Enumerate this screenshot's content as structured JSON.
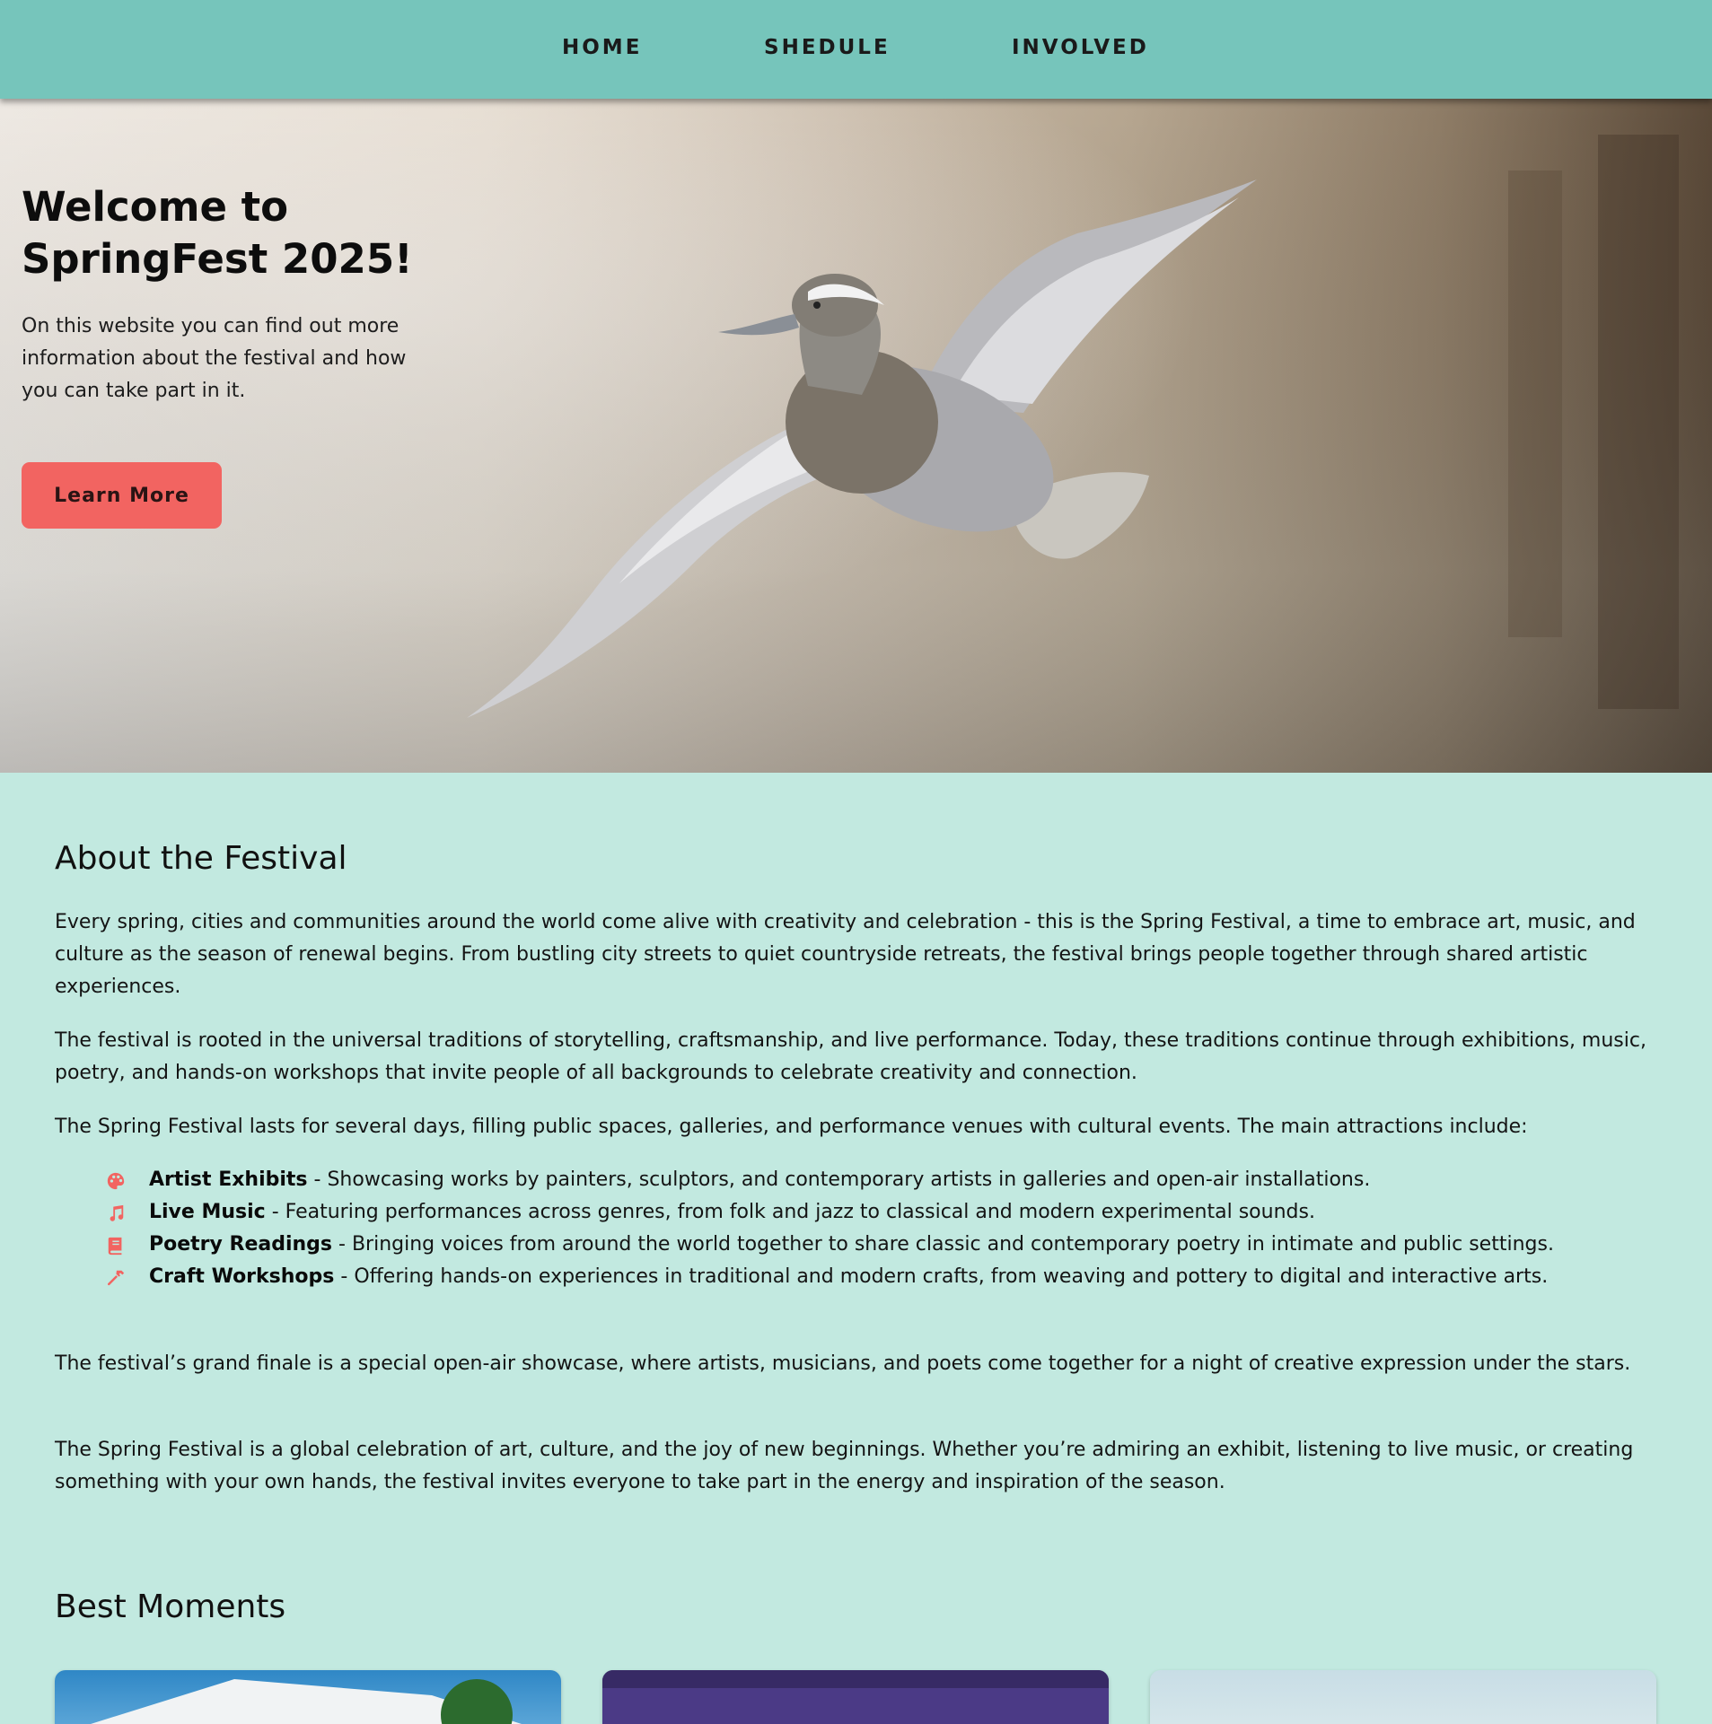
{
  "nav": {
    "items": [
      {
        "label": "HOME"
      },
      {
        "label": "SHEDULE"
      },
      {
        "label": "INVOLVED"
      }
    ]
  },
  "hero": {
    "title": "Welcome to SpringFest 2025!",
    "text": "On this website you can find out more information about the festival and how you can take part in it.",
    "button_label": "Learn More",
    "button_color": "#f26461"
  },
  "about": {
    "title": "About the Festival",
    "paragraphs": [
      "Every spring, cities and communities around the world come alive with creativity and celebration - this is the Spring Festival, a time to embrace art, music, and culture as the season of renewal begins. From bustling city streets to quiet countryside retreats, the festival brings people together through shared artistic experiences.",
      "The festival is rooted in the universal traditions of storytelling, craftsmanship, and live performance. Today, these traditions continue through exhibitions, music, poetry, and hands-on workshops that invite people of all backgrounds to celebrate creativity and connection.",
      "The Spring Festival lasts for several days, filling public spaces, galleries, and performance venues with cultural events. The main attractions include:",
      "The festival’s grand finale is a special open-air showcase, where artists, musicians, and poets come together for a night of creative expression under the stars.",
      "The Spring Festival is a global celebration of art, culture, and the joy of new beginnings. Whether you’re admiring an exhibit, listening to live music, or creating something with your own hands, the festival invites everyone to take part in the energy and inspiration of the season."
    ],
    "attractions": [
      {
        "icon": "palette-icon",
        "name": "Artist Exhibits",
        "desc": " - Showcasing works by painters, sculptors, and contemporary artists in galleries and open-air installations."
      },
      {
        "icon": "music-note-icon",
        "name": "Live Music",
        "desc": " - Featuring performances across genres, from folk and jazz to classical and modern experimental sounds."
      },
      {
        "icon": "book-icon",
        "name": "Poetry Readings",
        "desc": " - Bringing voices from around the world together to share classic and contemporary poetry in intimate and public settings."
      },
      {
        "icon": "hammer-icon",
        "name": "Craft Workshops",
        "desc": " - Offering hands-on experiences in traditional and modern crafts, from weaving and pottery to digital and interactive arts."
      }
    ],
    "icon_color": "#f26461"
  },
  "moments": {
    "title": "Best Moments"
  },
  "colors": {
    "nav_bg": "#76c5bb",
    "page_bg": "#c2e9e0"
  }
}
